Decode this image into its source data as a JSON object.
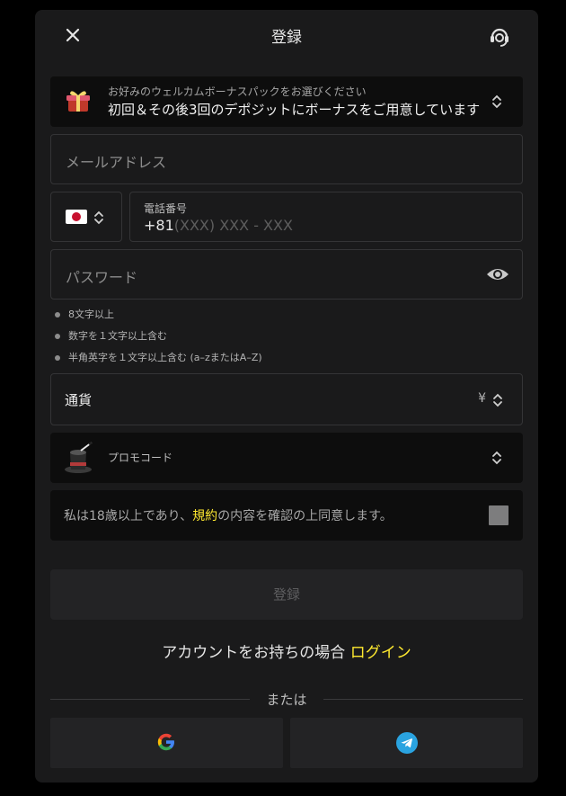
{
  "header": {
    "title": "登録",
    "close_icon": "close-icon",
    "support_icon": "headset-icon"
  },
  "bonus": {
    "caption": "お好みのウェルカムボーナスパックをお選びください",
    "selected": "初回＆その後3回のデポジットにボーナスをご用意しています",
    "icon": "gift-icon"
  },
  "email": {
    "placeholder": "メールアドレス"
  },
  "phone": {
    "country_flag": "japan-flag-icon",
    "label": "電話番号",
    "country_code": "+81",
    "mask": "(XXX) XXX - XXX"
  },
  "password": {
    "placeholder": "パスワード",
    "icon": "eye-icon",
    "rules": [
      "8文字以上",
      "数字を１文字以上含む",
      "半角英字を１文字以上含む (a–zまたはA–Z)"
    ]
  },
  "currency": {
    "label": "通貨",
    "symbol": "¥"
  },
  "promo": {
    "label": "プロモコード",
    "icon": "magic-hat-icon"
  },
  "agreement": {
    "prefix": "私は18歳以上であり、",
    "terms_link": "規約",
    "suffix": "の内容を確認の上同意します。"
  },
  "submit_label": "登録",
  "login": {
    "text": "アカウントをお持ちの場合 ",
    "link": "ログイン"
  },
  "divider_text": "または",
  "social": {
    "google_icon": "google-icon",
    "telegram_icon": "telegram-icon"
  },
  "colors": {
    "accent": "#ffe930",
    "panel": "#1a1a1b",
    "field_dark": "#0d0d0d",
    "telegram": "#2aa3e0"
  }
}
